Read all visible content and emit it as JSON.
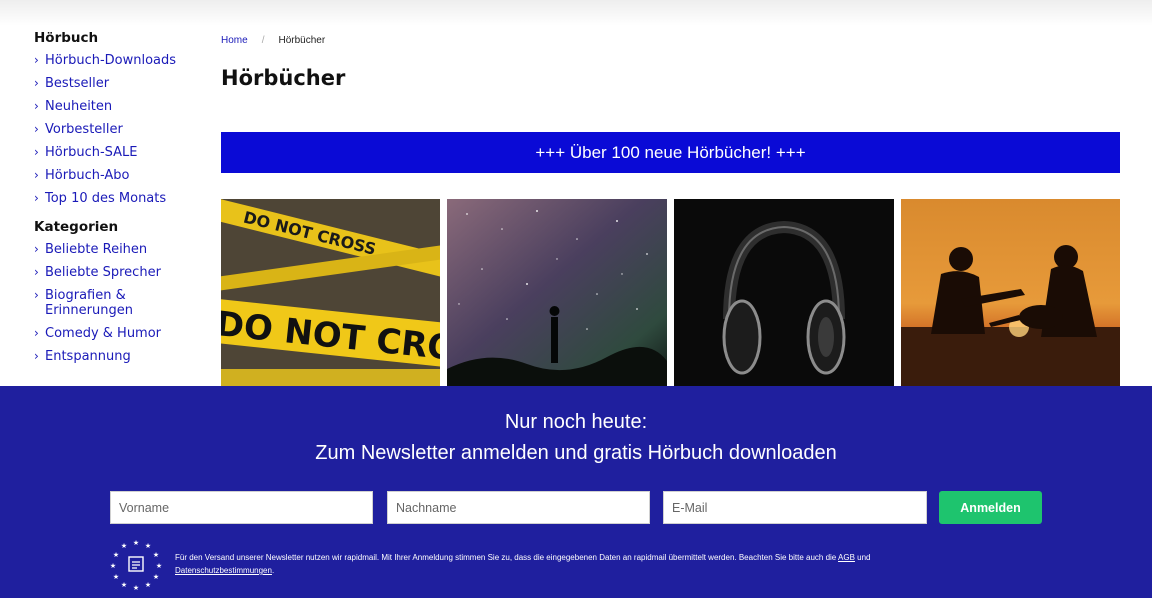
{
  "sidebar": {
    "heading1": "Hörbuch",
    "items1": [
      "Hörbuch-Downloads",
      "Bestseller",
      "Neuheiten",
      "Vorbesteller",
      "Hörbuch-SALE",
      "Hörbuch-Abo",
      "Top 10 des Monats"
    ],
    "heading2": "Kategorien",
    "items2": [
      "Beliebte Reihen",
      "Beliebte Sprecher",
      "Biografien &",
      "Erinnerungen",
      "Comedy & Humor",
      "Entspannung"
    ],
    "chevron": "›"
  },
  "breadcrumb": {
    "home": "Home",
    "separator": "/",
    "current": "Hörbücher"
  },
  "page": {
    "title": "Hörbücher"
  },
  "promo": {
    "text": "+++ Über 100 neue Hörbücher! +++",
    "color": "#0a0ad6"
  },
  "tiles": [
    {
      "name": "crime-tape-image",
      "tape_text": "DO NOT CROSS"
    },
    {
      "name": "starry-night-image"
    },
    {
      "name": "headphones-image"
    },
    {
      "name": "sunset-guitar-image"
    }
  ],
  "newsletter": {
    "line1": "Nur noch heute:",
    "line2": "Zum Newsletter anmelden und gratis Hörbuch downloaden",
    "firstname_placeholder": "Vorname",
    "lastname_placeholder": "Nachname",
    "email_placeholder": "E-Mail",
    "submit_label": "Anmelden",
    "note_text": "Für den Versand unserer Newsletter nutzen wir rapidmail. Mit Ihrer Anmeldung stimmen Sie zu, dass die eingegebenen Daten an rapidmail übermittelt werden. Beachten Sie bitte auch die ",
    "note_link_agb": "AGB",
    "note_and": " und",
    "note_link_privacy": "Datenschutzbestimmungen",
    "note_end": ".",
    "background": "#1f1f9e",
    "button_color": "#1ec46e"
  }
}
